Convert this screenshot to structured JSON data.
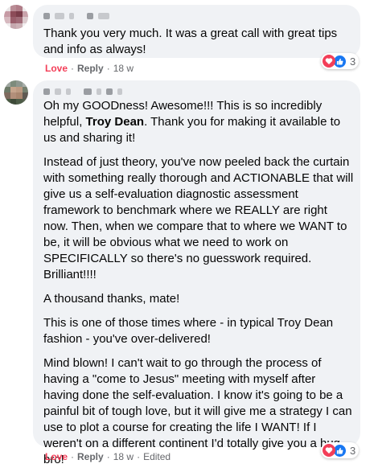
{
  "comments": [
    {
      "paragraphs": [
        [
          "Thank you very much. It was a great call with great tips and info as always!"
        ]
      ],
      "actions": {
        "love": "Love",
        "sep1": "·",
        "reply": "Reply",
        "sep2": "·",
        "time": "18 w"
      },
      "reaction_count": "3"
    },
    {
      "paragraphs": [
        [
          "Oh my GOODness! Awesome!!! This is so incredibly helpful, ",
          "Troy Dean",
          ". Thank you for making it available to us and sharing it!"
        ],
        [
          "Instead of just theory, you've now peeled back the curtain with something really thorough and ACTIONABLE that will give us a self-evaluation diagnostic assessment framework to benchmark where we REALLY are right now. Then, when we compare that to where we WANT to be, it will be obvious what we need to work on SPECIFICALLY so there's no guesswork required. Brilliant!!!!"
        ],
        [
          "A thousand thanks, mate!"
        ],
        [
          "This is one of those times where - in typical Troy Dean fashion - you've over-delivered!"
        ],
        [
          "Mind blown! I can't wait to go through the process of having a \"come to Jesus\" meeting with myself after having done the self-evaluation. I know it's going to be a painful bit of tough love, but it will give me a strategy I can use to plot a course for creating the life I WANT! If I weren't on a different continent I'd totally give you a hug bro!"
        ]
      ],
      "actions": {
        "love": "Love",
        "sep1": "·",
        "reply": "Reply",
        "sep2": "·",
        "time": "18 w",
        "sep3": "·",
        "edited": "Edited"
      },
      "reaction_count": "3"
    }
  ],
  "colors": {
    "love": "#f33e58",
    "like": "#1877f2",
    "bubble": "#f0f2f5",
    "meta": "#65676b"
  },
  "icons": {
    "love": "heart-icon",
    "like": "thumbs-up-icon"
  }
}
